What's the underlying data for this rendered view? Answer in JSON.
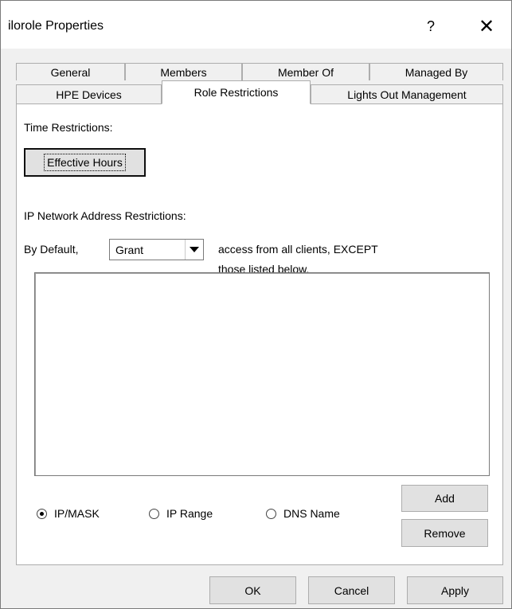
{
  "window": {
    "title": "ilorole Properties",
    "help_glyph": "?",
    "close_glyph": "✕"
  },
  "tabs": {
    "row_back": [
      "General",
      "Members",
      "Member Of",
      "Managed By"
    ],
    "row_front": [
      "HPE Devices",
      "Role Restrictions",
      "Lights Out Management"
    ],
    "active": "Role Restrictions"
  },
  "panel": {
    "time_label": "Time Restrictions:",
    "effective_hours_button": "Effective Hours",
    "ip_label": "IP Network Address Restrictions:",
    "by_default_label": "By Default,",
    "default_select": {
      "value": "Grant"
    },
    "except_line1": "access from all clients, EXCEPT",
    "except_line2": "those listed below.",
    "radio_options": [
      {
        "label": "IP/MASK",
        "checked": true
      },
      {
        "label": "IP Range",
        "checked": false
      },
      {
        "label": "DNS Name",
        "checked": false
      }
    ],
    "add_button": "Add",
    "remove_button": "Remove"
  },
  "footer": {
    "ok_button": "OK",
    "cancel_button": "Cancel",
    "apply_button": "Apply"
  }
}
